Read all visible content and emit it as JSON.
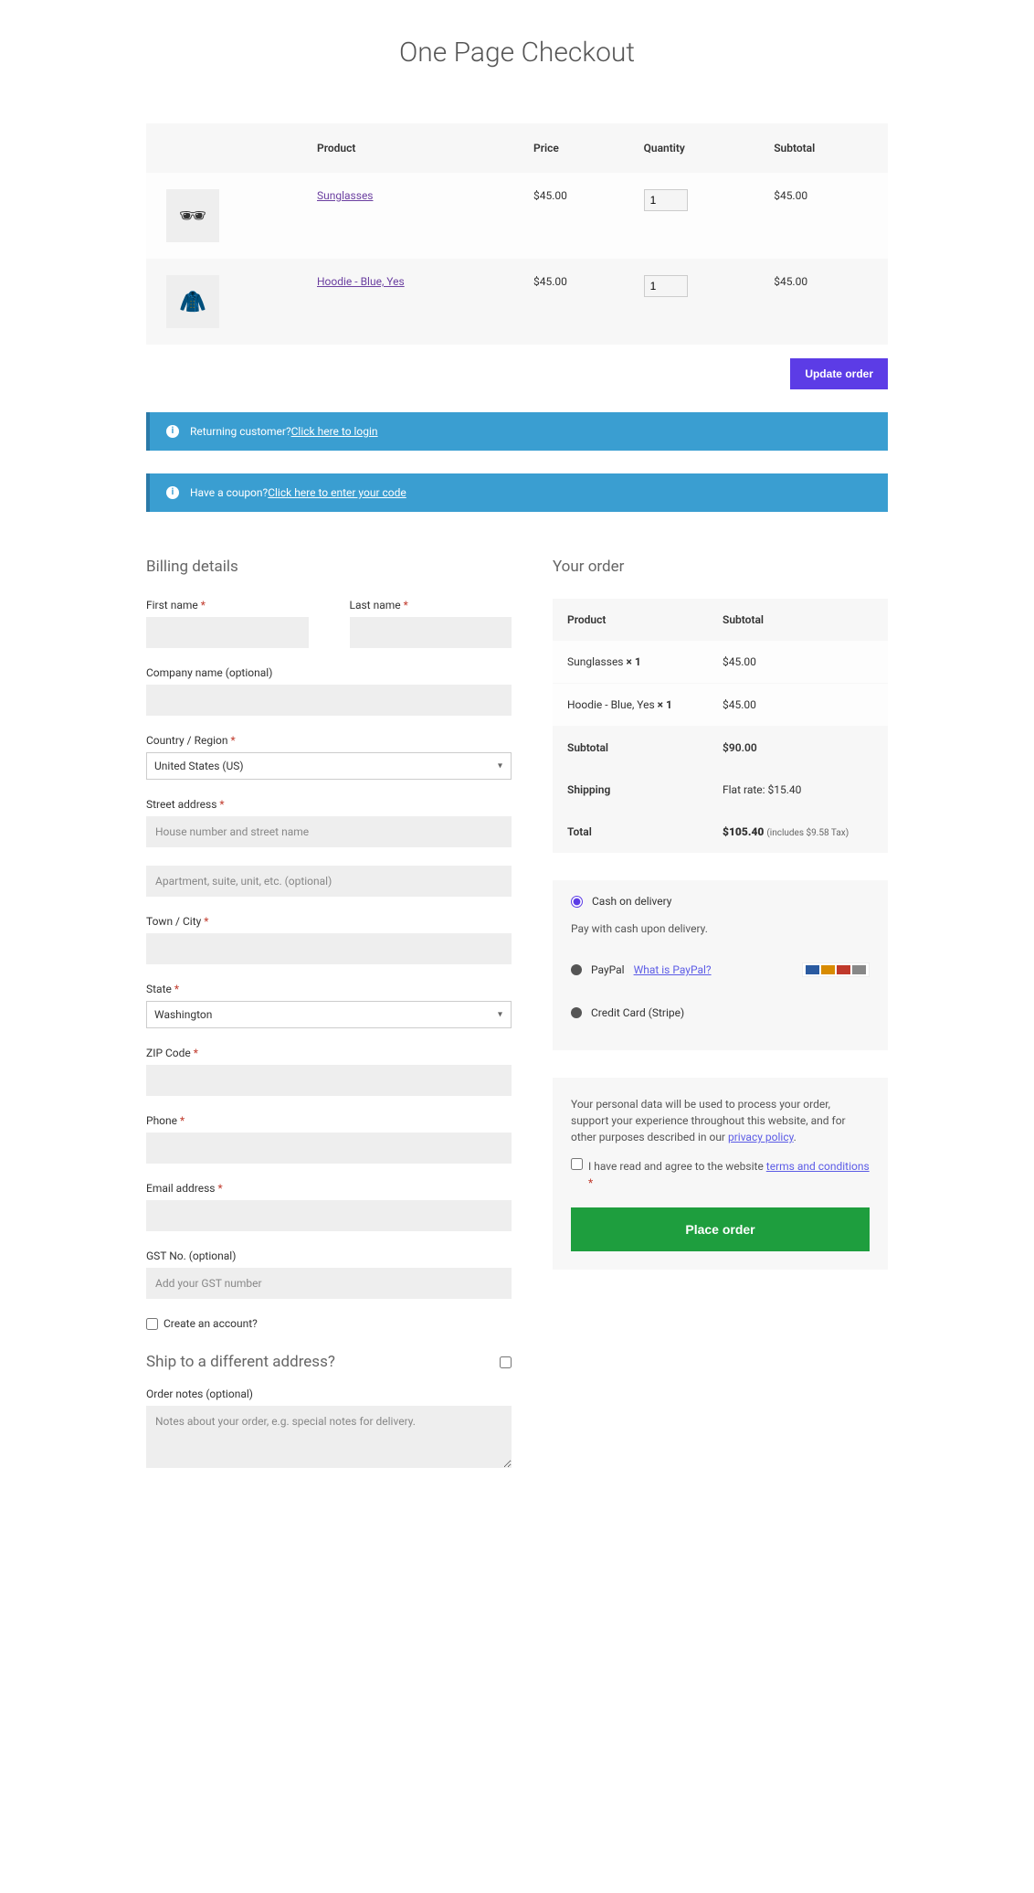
{
  "page_title": "One Page Checkout",
  "cart": {
    "headers": {
      "product": "Product",
      "price": "Price",
      "quantity": "Quantity",
      "subtotal": "Subtotal"
    },
    "items": [
      {
        "name": "Sunglasses",
        "price": "$45.00",
        "qty": "1",
        "subtotal": "$45.00",
        "icon": "🕶"
      },
      {
        "name": "Hoodie - Blue, Yes",
        "price": "$45.00",
        "qty": "1",
        "subtotal": "$45.00",
        "icon": "🧥"
      }
    ],
    "update_button": "Update order"
  },
  "banners": {
    "returning_prefix": "Returning customer? ",
    "returning_link": "Click here to login",
    "coupon_prefix": "Have a coupon? ",
    "coupon_link": "Click here to enter your code"
  },
  "billing": {
    "title": "Billing details",
    "first_name": "First name",
    "last_name": "Last name",
    "company": "Company name (optional)",
    "country": "Country / Region",
    "country_value": "United States (US)",
    "street": "Street address",
    "street_ph": "House number and street name",
    "street2_ph": "Apartment, suite, unit, etc. (optional)",
    "city": "Town / City",
    "state": "State",
    "state_value": "Washington",
    "zip": "ZIP Code",
    "phone": "Phone",
    "email": "Email address",
    "gst": "GST No. (optional)",
    "gst_ph": "Add your GST number",
    "create_account": "Create an account?"
  },
  "shipping": {
    "title": "Ship to a different address?",
    "notes_label": "Order notes (optional)",
    "notes_ph": "Notes about your order, e.g. special notes for delivery."
  },
  "order": {
    "title": "Your order",
    "headers": {
      "product": "Product",
      "subtotal": "Subtotal"
    },
    "lines": [
      {
        "name": "Sunglasses  ",
        "qty": "× 1",
        "subtotal": "$45.00"
      },
      {
        "name": "Hoodie - Blue, Yes  ",
        "qty": "× 1",
        "subtotal": "$45.00"
      }
    ],
    "subtotal_label": "Subtotal",
    "subtotal": "$90.00",
    "shipping_label": "Shipping",
    "shipping": "Flat rate: $15.40",
    "total_label": "Total",
    "total": "$105.40",
    "tax_note": "(includes $9.58 Tax)"
  },
  "payment": {
    "cod": "Cash on delivery",
    "cod_desc": "Pay with cash upon delivery.",
    "paypal": "PayPal",
    "paypal_link": "What is PayPal?",
    "stripe": "Credit Card (Stripe)"
  },
  "privacy": {
    "text": "Your personal data will be used to process your order, support your experience throughout this website, and for other purposes described in our ",
    "link": "privacy policy",
    "agree_prefix": "I have read and agree to the website ",
    "terms": "terms and conditions",
    "place_order": "Place order"
  }
}
